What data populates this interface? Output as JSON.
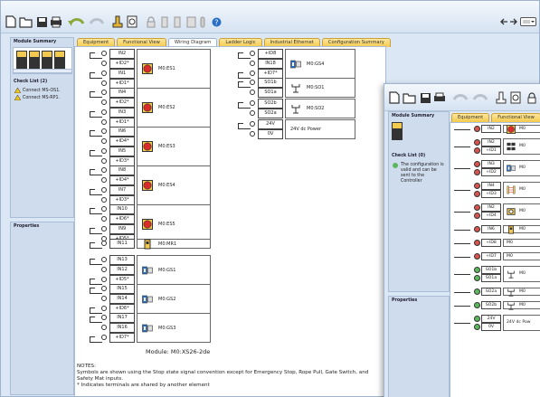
{
  "back": {
    "tabs": [
      "Equipment",
      "Functional View",
      "Wiring Diagram",
      "Ladder Logic",
      "Industrial Ethernet",
      "Configuration Summary"
    ],
    "active_tab": "Wiring Diagram",
    "module_summary": "Module Summary",
    "checklist_title": "Check List (2)",
    "checklist_items": [
      "Connect MS-OS1.",
      "Connect MS-RP1."
    ],
    "properties": "Properties",
    "module_name": "Module:  M0:XS26-2de",
    "notes_title": "NOTES:",
    "notes_line1": "Symbols are shown using the Stop state signal convention except for Emergency Stop, Rope Pull, Gate Switch, and Safety Mat inputs.",
    "notes_line2": "* Indicates terminals are shared by another element",
    "devices": [
      {
        "terms": [
          "IN2",
          "+ID2*",
          "IN1",
          "+ID1*"
        ],
        "label": "M0:ES1",
        "icon": "estop-icon"
      },
      {
        "terms": [
          "IN4",
          "+ID2*",
          "IN3",
          "+ID1*"
        ],
        "label": "M0:ES2",
        "icon": "estop-icon"
      },
      {
        "terms": [
          "IN6",
          "+ID4*",
          "IN5",
          "+ID3*"
        ],
        "label": "M0:ES3",
        "icon": "estop-icon"
      },
      {
        "terms": [
          "IN8",
          "+ID4*",
          "IN7",
          "+ID3*"
        ],
        "label": "M0:ES4",
        "icon": "estop-icon"
      },
      {
        "terms": [
          "IN10",
          "+ID6*",
          "IN9",
          "+ID5*"
        ],
        "label": "M0:ES5",
        "icon": "estop-icon"
      },
      {
        "terms": [
          "IN11"
        ],
        "label": "M0:MR1",
        "icon": "reset-icon"
      },
      {
        "terms": [
          "IN13",
          "IN12",
          "+ID5*"
        ],
        "label": "M0:GS1",
        "icon": "gate-switch-icon"
      },
      {
        "terms": [
          "IN15",
          "IN14",
          "+ID6*"
        ],
        "label": "M0:GS2",
        "icon": "gate-switch-icon"
      },
      {
        "terms": [
          "IN17",
          "IN16",
          "+ID7*"
        ],
        "label": "M0:GS3",
        "icon": "gate-switch-icon"
      }
    ],
    "right_devices": [
      {
        "terms": [
          "+ID8",
          "IN18",
          "+ID7*"
        ],
        "label": "M0:GS4",
        "icon": "gate-switch-icon"
      },
      {
        "terms": [
          "SO1b",
          "SO1a"
        ],
        "label": "M0:SO1",
        "icon": "relay-icon"
      },
      {
        "terms": [
          "SO2b",
          "SO2a"
        ],
        "label": "M0:SO2",
        "icon": "relay-icon"
      },
      {
        "terms": [
          "24V",
          "0V"
        ],
        "label": "24V dc Power",
        "icon": ""
      }
    ]
  },
  "front": {
    "tabs": [
      "Equipment",
      "Functional View"
    ],
    "module_summary": "Module Summary",
    "checklist_title": "Check List (0)",
    "checklist_msg": "The configuration is valid and can be sent to the Controller",
    "properties": "Properties",
    "rows": [
      {
        "terms": [
          "IN2"
        ],
        "icon": "estop-icon",
        "tag": "M0"
      },
      {
        "terms": [
          "IN2",
          "+ID1"
        ],
        "icon": "two-hand-icon",
        "tag": "M0"
      },
      {
        "terms": [
          "IN3",
          "+ID2"
        ],
        "icon": "gate-switch-icon",
        "tag": "M0"
      },
      {
        "terms": [
          "IN4",
          "+ID3"
        ],
        "icon": "light-curtain-icon",
        "tag": "M0"
      },
      {
        "terms": [
          "IN2",
          "+ID4"
        ],
        "icon": "mute-icon",
        "tag": "M0"
      },
      {
        "terms": [
          "IN6"
        ],
        "icon": "reset-icon",
        "tag": "M0"
      },
      {
        "terms": [
          "+ID8"
        ],
        "icon": "",
        "tag": "M0"
      },
      {
        "terms": [
          "+ID7"
        ],
        "icon": "",
        "tag": "M0"
      },
      {
        "terms": [
          "SO1b",
          "SO1a"
        ],
        "icon": "relay-icon",
        "tag": "M0"
      },
      {
        "terms": [
          "SO2a"
        ],
        "icon": "relay-icon",
        "tag": "M0"
      },
      {
        "terms": [
          "SO2b"
        ],
        "icon": "relay-icon",
        "tag": "M0"
      },
      {
        "terms": [
          "24V",
          "0V"
        ],
        "icon": "",
        "tag": "24V dc Pow"
      }
    ]
  },
  "colors": {
    "red_status": "#d9534f",
    "green_status": "#5cb85c",
    "tab_yellow": "#f3c94e"
  }
}
